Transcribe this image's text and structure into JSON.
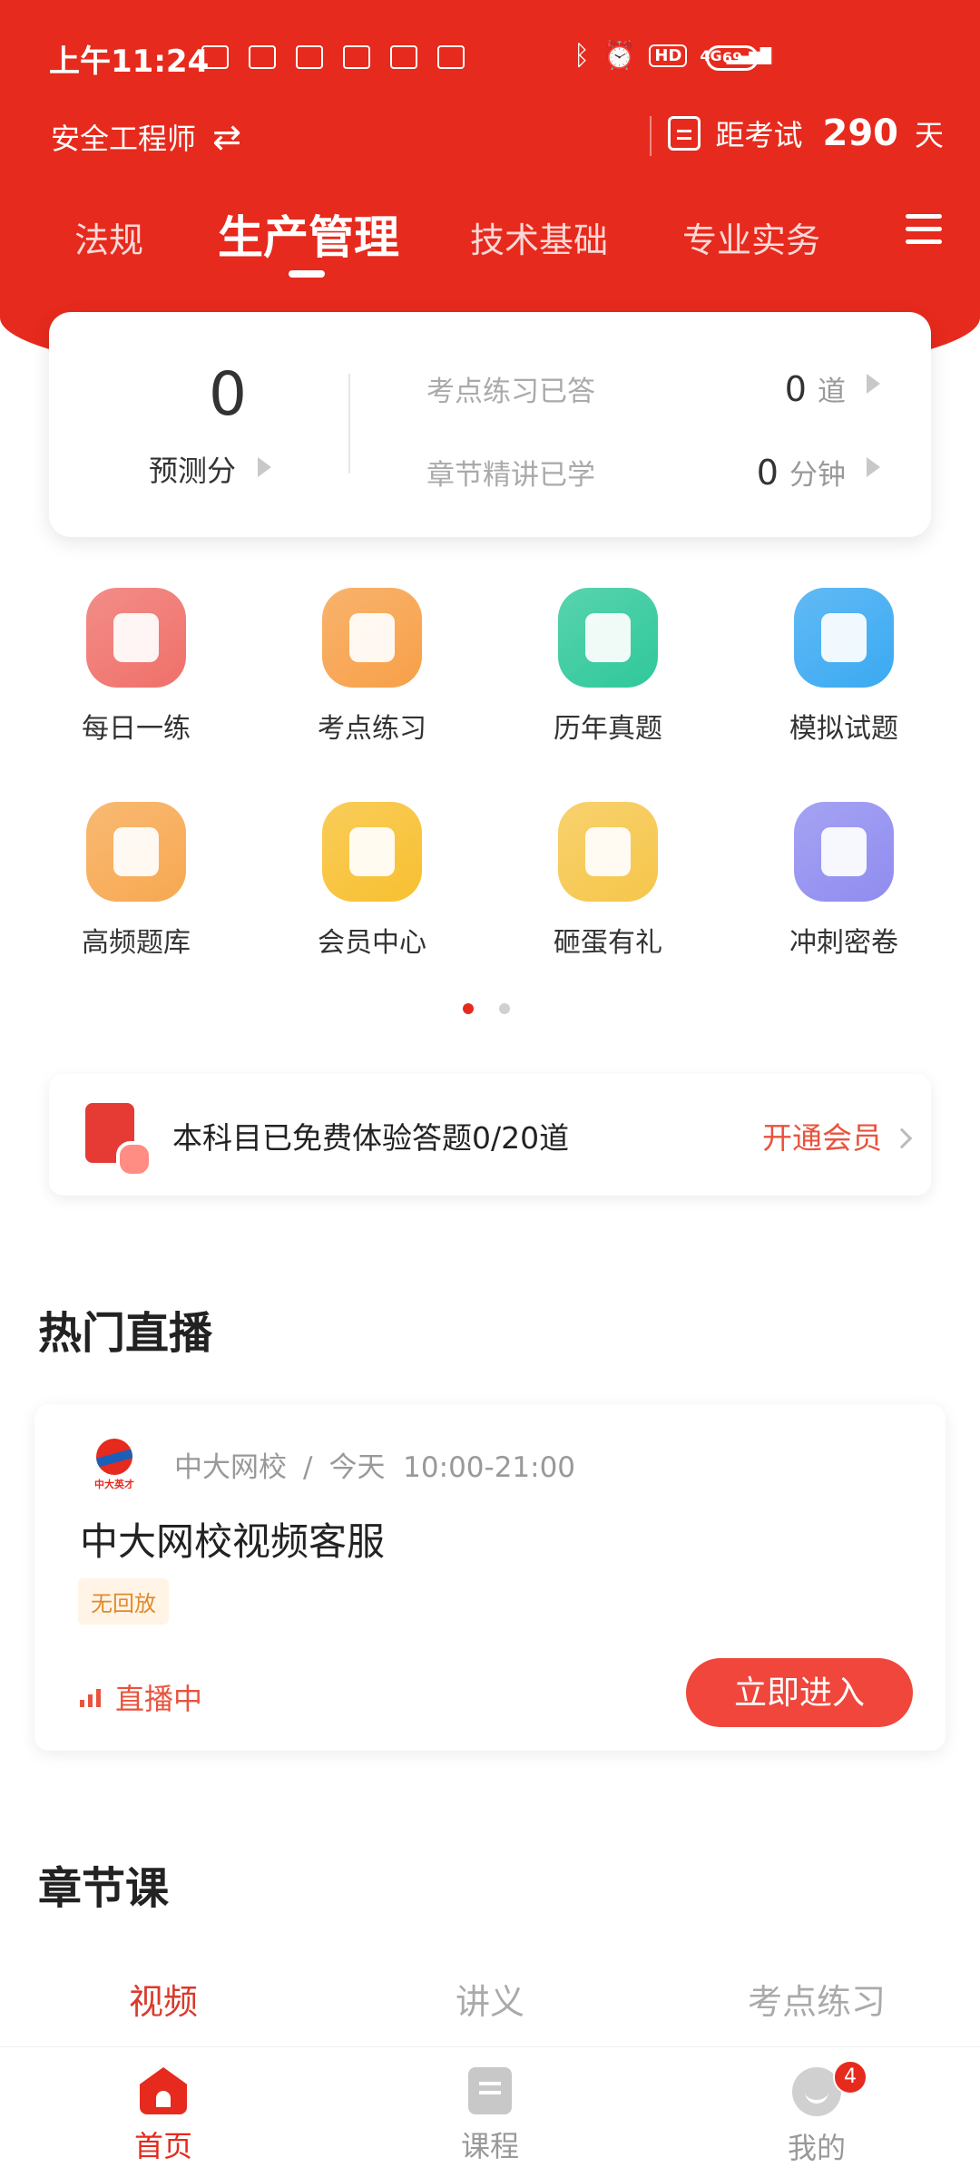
{
  "status_bar": {
    "time": "上午11:24",
    "hd": "HD",
    "network": "4G",
    "battery": "69"
  },
  "header": {
    "subject": "安全工程师",
    "exam_prefix": "距考试",
    "exam_days": "290",
    "exam_suffix": "天"
  },
  "tabs": [
    {
      "label": "法规"
    },
    {
      "label": "生产管理"
    },
    {
      "label": "技术基础"
    },
    {
      "label": "专业实务"
    }
  ],
  "stats": {
    "score_value": "0",
    "score_label": "预测分",
    "rows": [
      {
        "label": "考点练习已答",
        "value": "0",
        "unit": "道"
      },
      {
        "label": "章节精讲已学",
        "value": "0",
        "unit": "分钟"
      }
    ]
  },
  "grid": [
    {
      "label": "每日一练",
      "color": "#f0706a",
      "icon": "calendar-check-icon"
    },
    {
      "label": "考点练习",
      "color": "#f7a048",
      "icon": "lightning-doc-icon"
    },
    {
      "label": "历年真题",
      "color": "#2fc89a",
      "icon": "document-icon"
    },
    {
      "label": "模拟试题",
      "color": "#3aa9f2",
      "icon": "monitor-chart-icon"
    },
    {
      "label": "高频题库",
      "color": "#f7a850",
      "icon": "pulse-scroll-icon"
    },
    {
      "label": "会员中心",
      "color": "#f8c030",
      "icon": "crown-icon"
    },
    {
      "label": "砸蛋有礼",
      "color": "#f6c64a",
      "icon": "golden-egg-icon"
    },
    {
      "label": "冲刺密卷",
      "color": "#8f8cf0",
      "icon": "book-icon"
    }
  ],
  "banner": {
    "text": "本科目已免费体验答题0/20道",
    "cta": "开通会员"
  },
  "live": {
    "section_title": "热门直播",
    "logo_text": "中大英才",
    "org": "中大网校",
    "day": "今天",
    "time": "10:00-21:00",
    "title": "中大网校视频客服",
    "tag": "无回放",
    "status": "直播中",
    "button": "立即进入"
  },
  "chapters": {
    "section_title": "章节课",
    "tabs": [
      "视频",
      "讲义",
      "考点练习"
    ]
  },
  "bottom_nav": {
    "items": [
      {
        "label": "首页"
      },
      {
        "label": "课程"
      },
      {
        "label": "我的"
      }
    ],
    "badge": "4"
  },
  "colors": {
    "brand_red": "#e62a1d",
    "accent_orange": "#e8533e"
  }
}
